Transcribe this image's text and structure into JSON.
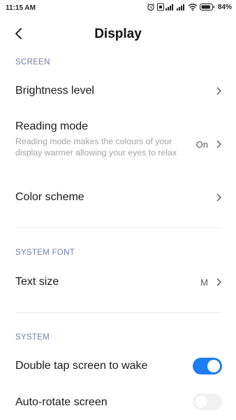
{
  "status_bar": {
    "time": "11:15 AM",
    "battery_percent": "84%",
    "icons": [
      "alarm-icon",
      "sim1-signal-icon",
      "sim2-signal-icon",
      "wifi-icon",
      "battery-icon"
    ]
  },
  "header": {
    "title": "Display",
    "back_icon": "back-arrow-icon"
  },
  "sections": {
    "screen": {
      "title": "SCREEN",
      "brightness_label": "Brightness level",
      "reading_label": "Reading mode",
      "reading_desc": "Reading mode makes the colours of your display warmer allowing your eyes to relax",
      "reading_value": "On",
      "color_label": "Color scheme"
    },
    "system_font": {
      "title": "SYSTEM FONT",
      "text_size_label": "Text size",
      "text_size_value": "M"
    },
    "system": {
      "title": "SYSTEM",
      "double_tap_label": "Double tap screen to wake",
      "double_tap_enabled": true,
      "auto_rotate_label": "Auto-rotate screen",
      "auto_rotate_enabled": false
    }
  },
  "colors": {
    "accent": "#1c7ef0",
    "section_header": "#6f7fa8"
  }
}
